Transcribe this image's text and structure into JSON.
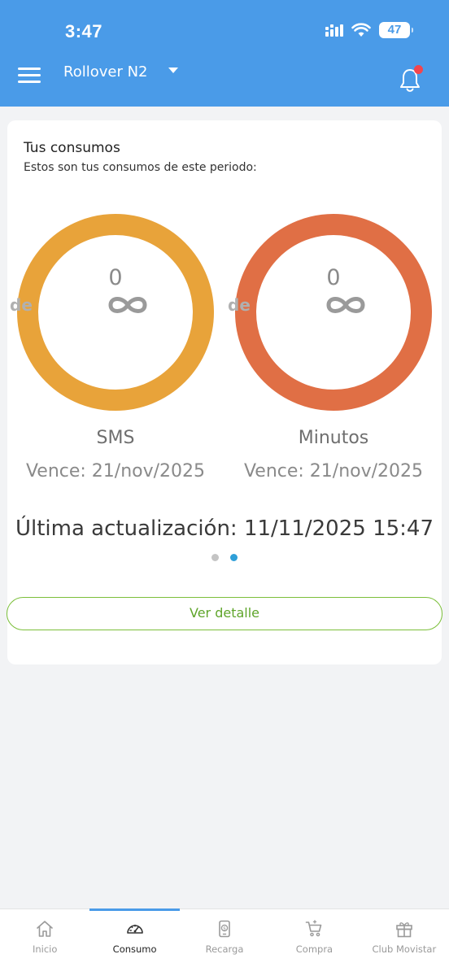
{
  "status_bar": {
    "time": "3:47",
    "battery": "47"
  },
  "header": {
    "title": "Rollover N2"
  },
  "card": {
    "title": "Tus consumos",
    "subtitle": "Estos son tus consumos de este periodo:",
    "gauges": [
      {
        "value": "0",
        "of": "de",
        "label": "SMS",
        "expiry": "Vence: 21/nov/2025",
        "color": "#e8a33a"
      },
      {
        "value": "0",
        "of": "de",
        "label": "Minutos",
        "expiry": "Vence: 21/nov/2025",
        "color": "#e06f45"
      }
    ],
    "updated": "Última actualización: 11/11/2025 15:47",
    "detail_button": "Ver detalle"
  },
  "colors": {
    "header": "#4a9be8",
    "accent_green": "#5fa52b",
    "active_dot": "#2e9fd8"
  },
  "bottom_nav": {
    "items": [
      {
        "label": "Inicio",
        "icon": "home-icon"
      },
      {
        "label": "Consumo",
        "icon": "gauge-icon",
        "active": true
      },
      {
        "label": "Recarga",
        "icon": "recharge-phone-icon"
      },
      {
        "label": "Compra",
        "icon": "cart-icon"
      },
      {
        "label": "Club Movistar",
        "icon": "gift-icon"
      }
    ]
  }
}
